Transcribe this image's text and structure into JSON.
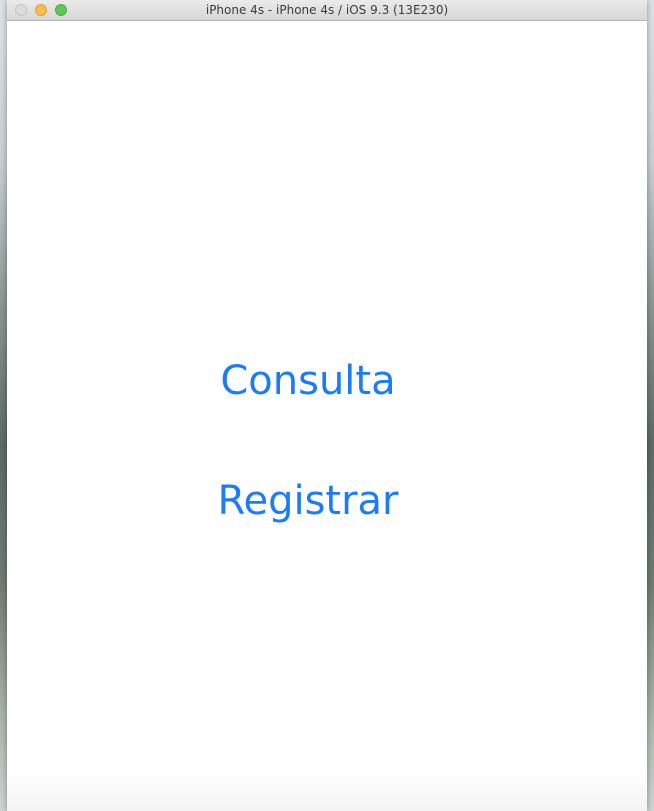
{
  "window": {
    "title": "iPhone 4s - iPhone 4s / iOS 9.3 (13E230)"
  },
  "app": {
    "buttons": [
      {
        "label": "Consulta"
      },
      {
        "label": "Registrar"
      }
    ]
  },
  "colors": {
    "ios_tint": "#1b7cf6",
    "screen_background": "#ffffff",
    "close_light": "#dcdcdc",
    "minimize_light": "#f6bd4f",
    "zoom_light": "#5fc754"
  },
  "icons": {
    "close": "close-icon",
    "minimize": "minimize-icon",
    "zoom": "zoom-icon"
  }
}
